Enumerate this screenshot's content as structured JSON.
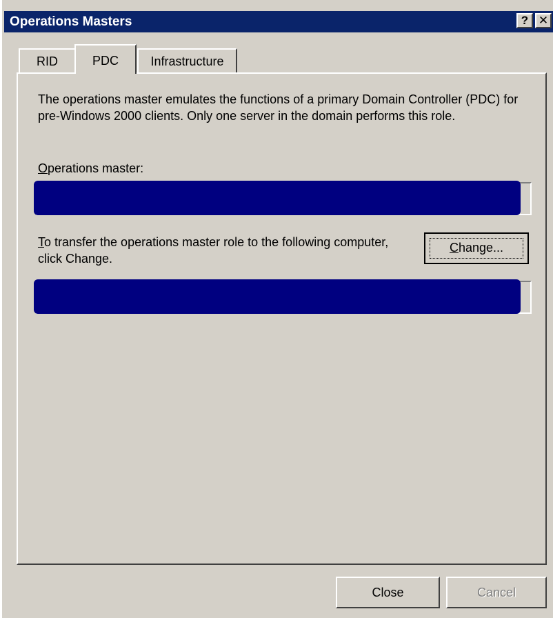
{
  "window": {
    "title": "Operations Masters",
    "help_glyph": "?",
    "close_glyph": "✕",
    "title_bar_color": "#0a246a",
    "corner_mark": ")"
  },
  "tabs": [
    {
      "label": "RID",
      "selected": false
    },
    {
      "label": "PDC",
      "selected": true
    },
    {
      "label": "Infrastructure",
      "selected": false
    }
  ],
  "pdc": {
    "description": "The operations master emulates the functions of a primary Domain Controller (PDC) for pre-Windows 2000 clients. Only one server in the domain performs this role.",
    "operations_master_label_access": "O",
    "operations_master_label_rest": "perations master:",
    "operations_master_value": "",
    "transfer_text_access": "T",
    "transfer_text_rest": "o transfer the operations master role to the following computer, click Change.",
    "change_button_access": "C",
    "change_button_rest": "hange...",
    "target_value": "",
    "redaction_color": "#000080"
  },
  "footer": {
    "close_label": "Close",
    "cancel_label": "Cancel"
  }
}
